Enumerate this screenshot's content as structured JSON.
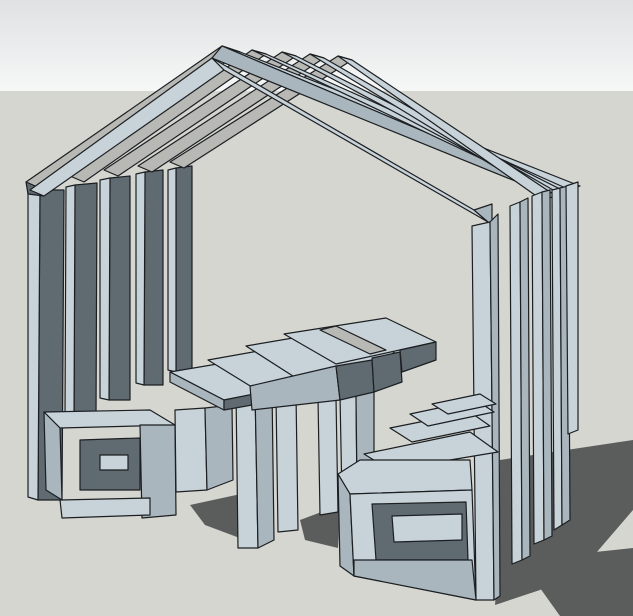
{
  "viewport": {
    "sky_color_top": "#dfe1e2",
    "sky_color_bottom": "#f6f7f7",
    "ground_color": "#d6d6d0",
    "shadow_color": "#5b5d5d"
  },
  "model": {
    "face_light": "#c8d3d9",
    "face_mid": "#a9b6bd",
    "face_dark": "#5f6a71",
    "face_gray": "#b8b8b4",
    "edge_color": "#1c1f22"
  }
}
